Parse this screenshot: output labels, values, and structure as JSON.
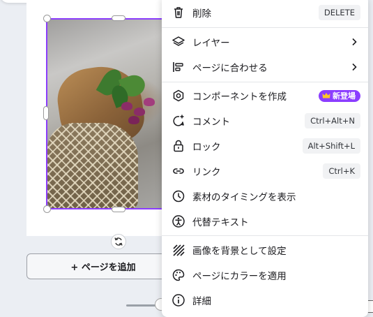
{
  "canvas": {
    "add_page_label": "+ ページを追加",
    "selection_color": "#8b3dff"
  },
  "context_menu": {
    "items": [
      {
        "icon": "trash-icon",
        "label": "削除",
        "shortcut": "DELETE"
      },
      {
        "icon": "layers-icon",
        "label": "レイヤー",
        "submenu": true
      },
      {
        "icon": "align-icon",
        "label": "ページに合わせる",
        "submenu": true
      },
      {
        "icon": "component-icon",
        "label": "コンポーネントを作成",
        "badge": "新登場"
      },
      {
        "icon": "comment-add-icon",
        "label": "コメント",
        "shortcut": "Ctrl+Alt+N"
      },
      {
        "icon": "lock-icon",
        "label": "ロック",
        "shortcut": "Alt+Shift+L"
      },
      {
        "icon": "link-icon",
        "label": "リンク",
        "shortcut": "Ctrl+K"
      },
      {
        "icon": "clock-icon",
        "label": "素材のタイミングを表示"
      },
      {
        "icon": "accessibility-icon",
        "label": "代替テキスト"
      },
      {
        "icon": "background-pattern-icon",
        "label": "画像を背景として設定"
      },
      {
        "icon": "palette-icon",
        "label": "ページにカラーを適用"
      },
      {
        "icon": "info-icon",
        "label": "詳細"
      }
    ],
    "badge_color": "#8b3dff",
    "crown_icon": "crown-icon"
  }
}
